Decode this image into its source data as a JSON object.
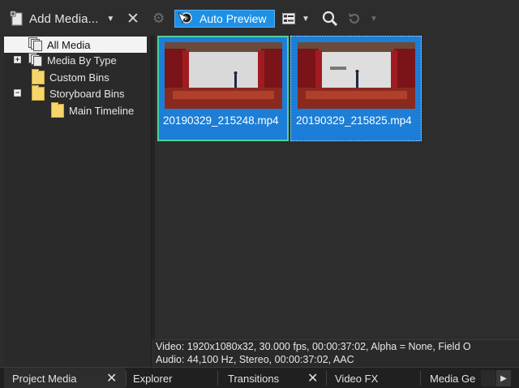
{
  "toolbar": {
    "add_media_label": "Add Media...",
    "auto_preview_label": "Auto Preview",
    "icons": [
      "add-media-icon",
      "caret-down-icon",
      "remove-icon",
      "gear-icon",
      "auto-preview-icon",
      "views-icon",
      "zoom-icon",
      "undo-icon"
    ]
  },
  "tree": {
    "items": [
      {
        "label": "All Media",
        "selected": true
      },
      {
        "label": "Media By Type",
        "expander": "+"
      },
      {
        "label": "Custom Bins"
      },
      {
        "label": "Storyboard Bins",
        "expander": "−"
      },
      {
        "label": "Main Timeline"
      }
    ]
  },
  "media": {
    "items": [
      {
        "filename": "20190329_215248.mp4",
        "active": true
      },
      {
        "filename": "20190329_215825.mp4",
        "active": false
      }
    ]
  },
  "info": {
    "video": "Video: 1920x1080x32, 30.000 fps, 00:00:37:02, Alpha = None, Field O",
    "audio": "Audio: 44,100 Hz, Stereo, 00:00:37:02, AAC"
  },
  "tabs": [
    {
      "label": "Project Media",
      "active": true,
      "closable": true
    },
    {
      "label": "Explorer"
    },
    {
      "label": "Transitions",
      "closable": true
    },
    {
      "label": "Video FX"
    },
    {
      "label": "Media Ge"
    }
  ],
  "colors": {
    "selection_blue": "#1c7ed6",
    "auto_preview_blue": "#1e90e6",
    "active_outline": "#4fd1a0",
    "folder_yellow": "#f6d56b"
  }
}
